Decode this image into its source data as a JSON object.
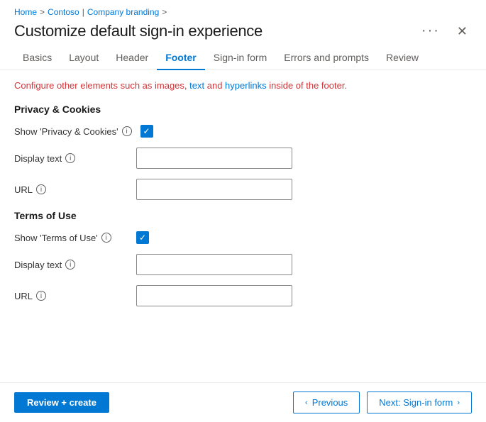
{
  "breadcrumb": {
    "home": "Home",
    "contoso": "Contoso",
    "separator1": ">",
    "company_branding": "Company branding",
    "separator2": ">"
  },
  "page": {
    "title": "Customize default sign-in experience",
    "ellipsis_label": "···",
    "close_label": "✕"
  },
  "tabs": [
    {
      "id": "basics",
      "label": "Basics",
      "active": false
    },
    {
      "id": "layout",
      "label": "Layout",
      "active": false
    },
    {
      "id": "header",
      "label": "Header",
      "active": false
    },
    {
      "id": "footer",
      "label": "Footer",
      "active": true
    },
    {
      "id": "signin-form",
      "label": "Sign-in form",
      "active": false
    },
    {
      "id": "errors-prompts",
      "label": "Errors and prompts",
      "active": false
    },
    {
      "id": "review",
      "label": "Review",
      "active": false
    }
  ],
  "info_message": {
    "text_before": "Configure other elements such as images,",
    "link_text": " text",
    "text_middle": " and",
    "link_text2": " hyperlinks",
    "text_after": " inside of the footer."
  },
  "privacy_section": {
    "title": "Privacy & Cookies",
    "show_label": "Show 'Privacy & Cookies'",
    "show_checked": true,
    "display_text_label": "Display text",
    "display_text_placeholder": "",
    "display_text_value": "",
    "url_label": "URL",
    "url_placeholder": "",
    "url_value": ""
  },
  "terms_section": {
    "title": "Terms of Use",
    "show_label": "Show 'Terms of Use'",
    "show_checked": true,
    "display_text_label": "Display text",
    "display_text_placeholder": "",
    "display_text_value": "",
    "url_label": "URL",
    "url_placeholder": "",
    "url_value": ""
  },
  "footer": {
    "review_create_label": "Review + create",
    "previous_label": "Previous",
    "next_label": "Next: Sign-in form"
  }
}
